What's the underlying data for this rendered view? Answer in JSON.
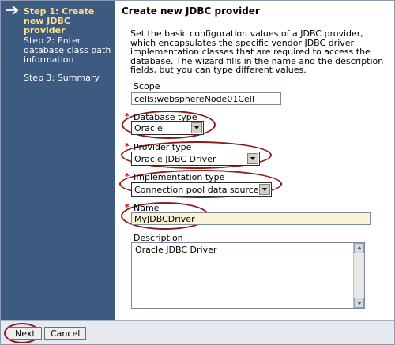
{
  "sidebar": {
    "steps": [
      {
        "label": "Step 1: Create new JDBC provider"
      },
      {
        "label": "Step 2: Enter database class path information"
      },
      {
        "label": "Step 3: Summary"
      }
    ]
  },
  "main": {
    "title": "Create new JDBC provider",
    "intro": "Set the basic configuration values of a JDBC provider, which encapsulates the specific vendor JDBC driver implementation classes that are required to access the database. The wizard fills in the name and the description fields, but you can type different values.",
    "scope": {
      "label": "Scope",
      "value": "cells:websphereNode01Cell"
    },
    "database_type": {
      "label": "Database type",
      "value": "Oracle"
    },
    "provider_type": {
      "label": "Provider type",
      "value": "Oracle JDBC Driver"
    },
    "implementation_type": {
      "label": "Implementation type",
      "value": "Connection pool data source"
    },
    "name": {
      "label": "Name",
      "value": "MyJDBCDriver"
    },
    "description": {
      "label": "Description",
      "value": "Oracle JDBC Driver"
    },
    "required_marker": "*"
  },
  "footer": {
    "next_label": "Next",
    "cancel_label": "Cancel"
  },
  "colors": {
    "sidebar_bg": "#3d5a80",
    "current_step": "#ffe08a",
    "highlight_ellipse": "#8b1a1a",
    "required": "#c00000"
  }
}
